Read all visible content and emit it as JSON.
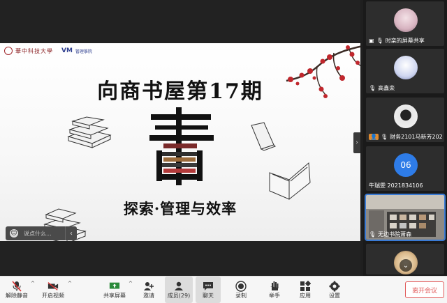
{
  "slide": {
    "logo_text": "華中科技大學",
    "logo_vm": "VM",
    "logo_small": "管理學院",
    "title": "向商书屋第17期",
    "big_char": "書",
    "subtitle": "探索·管理与效率"
  },
  "chat": {
    "placeholder": "说点什么...",
    "emoji_icon": "smile-icon"
  },
  "participants": [
    {
      "name": "时栾的屏幕共享",
      "icons": [
        "screen-share-icon",
        "mic-muted-icon"
      ]
    },
    {
      "name": "高鑫栾",
      "icons": [
        "mic-muted-icon"
      ]
    },
    {
      "name": "财务2101马新芳202151...",
      "icons": [
        "person-icon",
        "mic-muted-icon"
      ]
    },
    {
      "name": "牛瑞雯 2021834106",
      "avatar_text": "06",
      "icons": []
    },
    {
      "name": "无边书院萧森",
      "icons": [
        "mic-muted-icon"
      ]
    },
    {
      "name": "",
      "icons": []
    }
  ],
  "toolbar": {
    "unmute": "解除静音",
    "video": "开启视频",
    "share": "共享屏幕",
    "invite": "邀请",
    "members": "成员(29)",
    "chat": "聊天",
    "record": "录制",
    "raise_hand": "举手",
    "apps": "应用",
    "settings": "设置",
    "leave": "离开会议"
  },
  "colors": {
    "accent": "#3a7bd5",
    "leave": "#e15858",
    "seal_red": "#a0282c"
  }
}
